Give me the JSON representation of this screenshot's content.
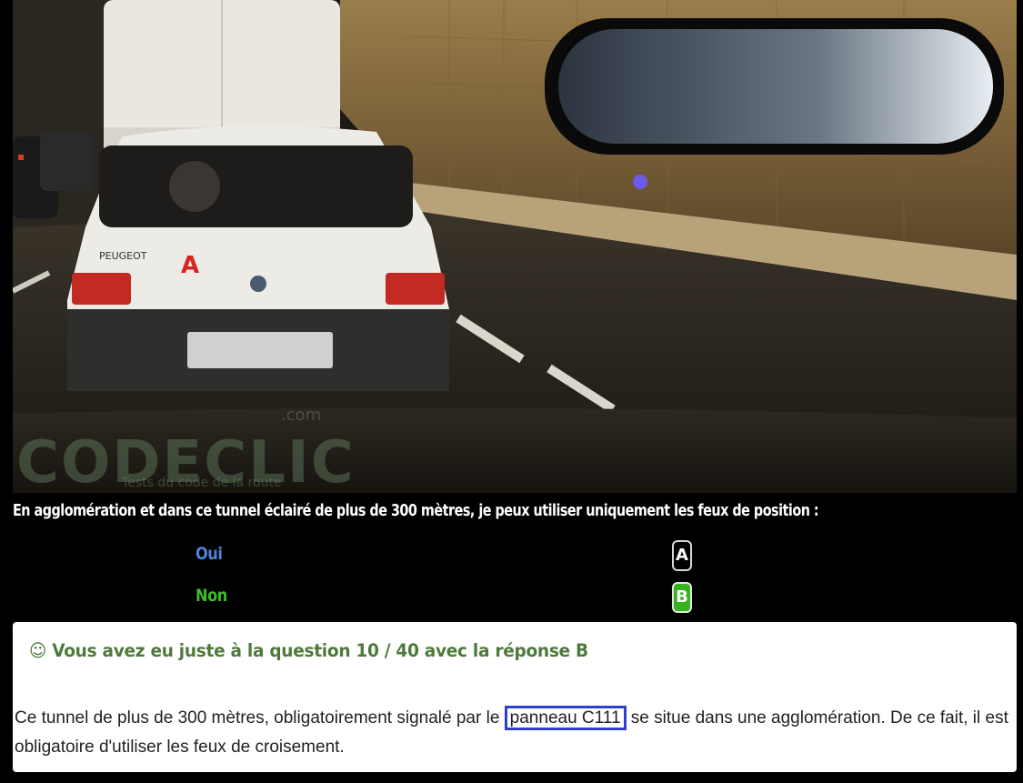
{
  "photo": {
    "watermark_brand": "CODECLIC",
    "watermark_tld": ".com",
    "watermark_tagline": "Tests du code de la route",
    "car_badge": "A",
    "car_make": "PEUGEOT"
  },
  "question": {
    "text": "En agglomération et dans ce tunnel éclairé de plus de 300 mètres, je peux utiliser uniquement les feux de position :"
  },
  "answers": [
    {
      "label": "Oui",
      "key": "A",
      "color": "#4e86d6"
    },
    {
      "label": "Non",
      "key": "B",
      "color": "#3fbf2a"
    }
  ],
  "result": {
    "icon": "smiley-icon",
    "icon_glyph": "☺",
    "title": "Vous avez eu juste à la question 10 / 40 avec la réponse B",
    "explain_before": "Ce tunnel de plus de 300 mètres, obligatoirement signalé par le ",
    "explain_link": "panneau C111",
    "explain_after": " se situe dans une agglomération. De ce fait, il est obligatoire d'utiliser les feux de croisement.",
    "title_color": "#4d7a3a",
    "highlight_color": "#2f3fcc"
  }
}
